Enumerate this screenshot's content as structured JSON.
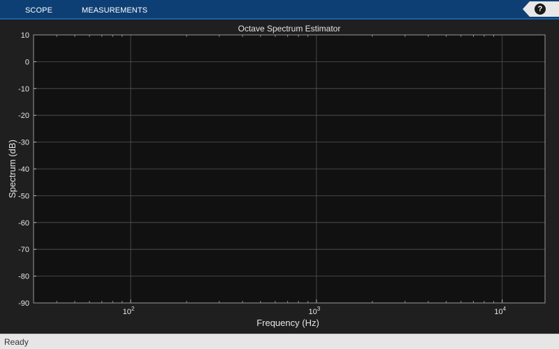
{
  "toolstrip": {
    "tabs": [
      {
        "label": "SCOPE"
      },
      {
        "label": "MEASUREMENTS"
      }
    ],
    "help_label": "?"
  },
  "status": {
    "text": "Ready"
  },
  "colors": {
    "toolstrip_bg": "#0e3f74",
    "plot_bg": "#111111",
    "figure_bg": "#1f1f1f",
    "grid": "#555555",
    "axis_text": "#e6e6e6"
  },
  "chart_data": {
    "type": "line",
    "title": "Octave Spectrum Estimator",
    "xlabel": "Frequency (Hz)",
    "ylabel": "Spectrum (dB)",
    "xscale": "log",
    "xlim": [
      30,
      17000
    ],
    "ylim": [
      -90,
      10
    ],
    "yticks": [
      10,
      0,
      -10,
      -20,
      -30,
      -40,
      -50,
      -60,
      -70,
      -80,
      -90
    ],
    "xticks": [
      {
        "value": 100,
        "base": "10",
        "exp": "2"
      },
      {
        "value": 1000,
        "base": "10",
        "exp": "3"
      },
      {
        "value": 10000,
        "base": "10",
        "exp": "4"
      }
    ],
    "grid": true,
    "series": []
  }
}
